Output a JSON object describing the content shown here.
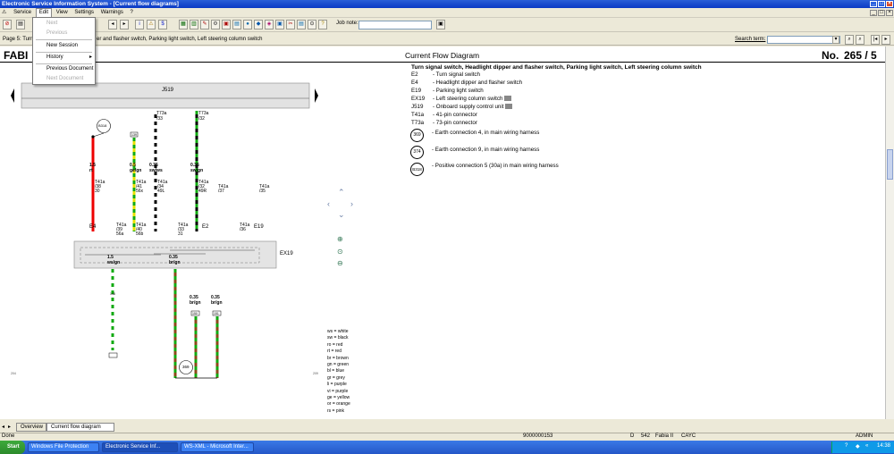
{
  "window": {
    "title": "Electronic Service Information System - [Current flow diagrams]"
  },
  "menu": {
    "items": [
      "Service",
      "Edit",
      "View",
      "Settings",
      "Warnings",
      "?"
    ]
  },
  "edit_menu": {
    "items": [
      {
        "label": "Next",
        "enabled": false
      },
      {
        "label": "Previous",
        "enabled": false
      },
      {
        "label": "New Session",
        "enabled": true
      },
      {
        "label": "History",
        "enabled": true
      },
      {
        "label": "Previous Document",
        "enabled": true
      },
      {
        "label": "Next Document",
        "enabled": false
      }
    ]
  },
  "toolbar": {
    "job_note_label": "Job note:"
  },
  "pagebar": {
    "page_text": "Page 5: Turn",
    "page_text_tail": "er and flasher switch, Parking light switch, Left steering column switch",
    "search_label": "Search term:"
  },
  "document": {
    "left_header": "FABI",
    "center_header": "Current Flow Diagram",
    "number_label": "No.",
    "number": "265 / 5",
    "subtitle": "Turn signal switch, Headlight dipper and flasher switch, Parking light switch, Left steering column switch",
    "legend": [
      {
        "code": "E2",
        "desc": "Turn signal switch"
      },
      {
        "code": "E4",
        "desc": "Headlight dipper and flasher switch"
      },
      {
        "code": "E19",
        "desc": "Parking light switch"
      },
      {
        "code": "EX19",
        "desc": "Left steering column switch"
      },
      {
        "code": "J519",
        "desc": "Onboard supply control unit"
      },
      {
        "code": "T41a",
        "desc": "41-pin connector"
      },
      {
        "code": "T73a",
        "desc": "73-pin connector"
      }
    ],
    "earth_legend": [
      {
        "code": "369",
        "desc": "Earth connection 4, in main wiring harness"
      },
      {
        "code": "374",
        "desc": "Earth connection 9, in main wiring harness"
      },
      {
        "code": "B318",
        "desc": "Positive connection 5 (30a) in main wiring harness"
      }
    ],
    "colors": [
      {
        "code": "ws",
        "name": "white"
      },
      {
        "code": "sw",
        "name": "black"
      },
      {
        "code": "ro",
        "name": "red"
      },
      {
        "code": "rt",
        "name": "red"
      },
      {
        "code": "br",
        "name": "brown"
      },
      {
        "code": "gn",
        "name": "green"
      },
      {
        "code": "bl",
        "name": "blue"
      },
      {
        "code": "gr",
        "name": "grey"
      },
      {
        "code": "li",
        "name": "purple"
      },
      {
        "code": "vi",
        "name": "purple"
      },
      {
        "code": "ge",
        "name": "yellow"
      },
      {
        "code": "or",
        "name": "orange"
      },
      {
        "code": "rs",
        "name": "pink"
      }
    ],
    "diagram": {
      "top_unit": "J519",
      "bottom_unit": "EX19",
      "b_conn": "B318",
      "earth": "369",
      "wires_top": [
        {
          "size": "1.5",
          "color": "rt",
          "pin": "T41a",
          "pinno": "/38",
          "sub": "30"
        },
        {
          "size": "0.5",
          "color": "ge/gn",
          "pin": "T41a",
          "pinno": "/41",
          "sub": "56x"
        },
        {
          "size": "0.35",
          "color": "sw/ws",
          "pin": "T41a",
          "pinno": "/34",
          "sub": "49L",
          "top_pin": "T73a",
          "top_pinno": "/33"
        },
        {
          "size": "0.35",
          "color": "sw/gn",
          "pin": "T41a",
          "pinno": "/32",
          "sub": "49R",
          "top_pin": "T73a",
          "top_pinno": "/32"
        }
      ],
      "wires_bottom": [
        {
          "size": "1.5",
          "color": "ws/gn",
          "pin": "T41a",
          "pinno": "/39",
          "sub": "56a"
        },
        {
          "size": "0.35",
          "color": "br/gn",
          "pin": "T41a",
          "pinno": "/33",
          "sub": "31"
        },
        {
          "size": "0.35",
          "color": "br/gn"
        },
        {
          "size": "0.35",
          "color": "br/gn"
        }
      ],
      "components": [
        "E4",
        "E2",
        "E19"
      ],
      "extra_pins": [
        {
          "pin": "T41a",
          "pinno": "/40",
          "sub": "56b"
        },
        {
          "pin": "T41a",
          "pinno": "/37"
        },
        {
          "pin": "T41a",
          "pinno": "/35"
        },
        {
          "pin": "T41a",
          "pinno": "/36"
        }
      ],
      "ref_boxes": [
        "148",
        "139",
        "150",
        "151"
      ],
      "edge_numbers": [
        "204",
        "209"
      ]
    }
  },
  "tabs": [
    {
      "label": "Overview"
    },
    {
      "label": "Current flow diagram"
    }
  ],
  "status": {
    "left": "Done",
    "order": "9000000153",
    "d": "D",
    "code": "542",
    "model": "Fabia II",
    "engine": "CAYC",
    "user": "ADMIN"
  },
  "taskbar": {
    "start": "Start",
    "tasks": [
      "Windows File Protection",
      "Electronic Service Inf...",
      "WS-XML - Microsoft Inter..."
    ],
    "clock": "14:38"
  },
  "accent": "#0a3ac4"
}
